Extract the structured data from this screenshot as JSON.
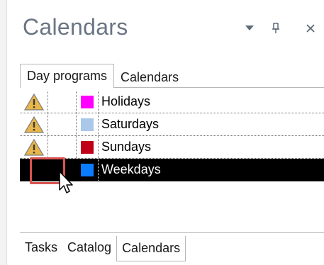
{
  "panel": {
    "title": "Calendars",
    "controls": {
      "dropdown_icon": "triangle-down-icon",
      "pin_icon": "pin-icon",
      "close_icon": "close-icon"
    }
  },
  "top_tabs": [
    {
      "label": "Day programs",
      "active": true
    },
    {
      "label": "Calendars",
      "active": false
    }
  ],
  "day_programs": [
    {
      "name": "Holidays",
      "warning": true,
      "color": "#ff00ff",
      "selected": false
    },
    {
      "name": "Saturdays",
      "warning": true,
      "color": "#a9c8ea",
      "selected": false
    },
    {
      "name": "Sundays",
      "warning": true,
      "color": "#c00018",
      "selected": false
    },
    {
      "name": "Weekdays",
      "warning": false,
      "color": "#0a7cff",
      "selected": true
    }
  ],
  "bottom_tabs": [
    {
      "label": "Tasks",
      "active": false
    },
    {
      "label": "Catalog",
      "active": false
    },
    {
      "label": "Calendars",
      "active": true
    }
  ],
  "colors": {
    "title_text": "#6a7584",
    "selected_row": "#000000",
    "highlight_box": "#d9534f",
    "warning_fill": "#e8b64a"
  }
}
